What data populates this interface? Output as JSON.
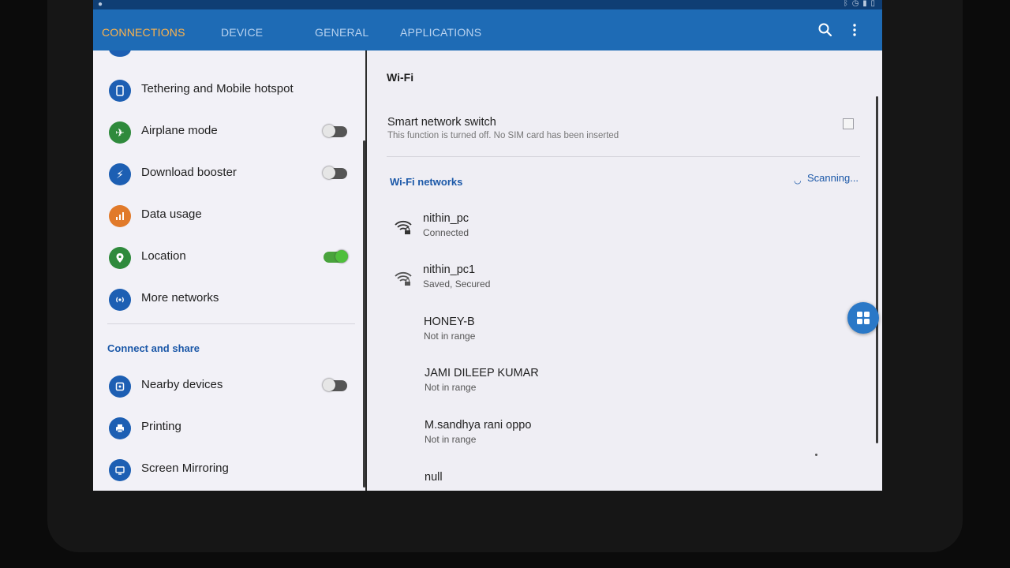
{
  "tabs": [
    {
      "label": "CONNECTIONS",
      "active": true
    },
    {
      "label": "DEVICE",
      "active": false
    },
    {
      "label": "GENERAL",
      "active": false
    },
    {
      "label": "APPLICATIONS",
      "active": false
    }
  ],
  "toolbar_icons": [
    "search-icon",
    "more-vertical-icon"
  ],
  "colors": {
    "tabbar": "#1e6bb5",
    "active_tab": "#ffb34a",
    "accent_blue": "#1b58a8",
    "toggle_on": "#4fbf3c"
  },
  "left_list": {
    "items": [
      {
        "label": "Tethering and Mobile hotspot",
        "icon": "hotspot-icon",
        "color": "#1d5fb3"
      },
      {
        "label": "Airplane mode",
        "icon": "airplane-icon",
        "color": "#2f8a3c",
        "toggle": false
      },
      {
        "label": "Download booster",
        "icon": "lightning-icon",
        "color": "#1d5fb3",
        "toggle": false
      },
      {
        "label": "Data usage",
        "icon": "bar-chart-icon",
        "color": "#e17a2a"
      },
      {
        "label": "Location",
        "icon": "location-pin-icon",
        "color": "#2f8a3c",
        "toggle": true
      },
      {
        "label": "More networks",
        "icon": "antenna-icon",
        "color": "#1d5fb3"
      }
    ],
    "section_header": "Connect and share",
    "share_items": [
      {
        "label": "Nearby devices",
        "icon": "nearby-devices-icon",
        "color": "#1d5fb3",
        "toggle": false
      },
      {
        "label": "Printing",
        "icon": "printer-icon",
        "color": "#1d5fb3"
      },
      {
        "label": "Screen Mirroring",
        "icon": "screen-mirroring-icon",
        "color": "#1d5fb3"
      }
    ]
  },
  "wifi_panel": {
    "title": "Wi-Fi",
    "smart_switch": {
      "title": "Smart network switch",
      "subtitle": "This function is turned off. No SIM card has been inserted",
      "checked": false
    },
    "networks_header": "Wi-Fi networks",
    "scanning_label": "Scanning...",
    "networks": [
      {
        "name": "nithin_pc",
        "status": "Connected",
        "icon": "wifi-lock-icon"
      },
      {
        "name": "nithin_pc1",
        "status": "Saved, Secured",
        "icon": "wifi-lock-icon"
      },
      {
        "name": "HONEY-B",
        "status": "Not in range",
        "icon": ""
      },
      {
        "name": "JAMI DILEEP KUMAR",
        "status": "Not in range",
        "icon": ""
      },
      {
        "name": "M.sandhya rani oppo",
        "status": "Not in range",
        "icon": ""
      },
      {
        "name": "null",
        "status": "",
        "icon": ""
      }
    ]
  }
}
